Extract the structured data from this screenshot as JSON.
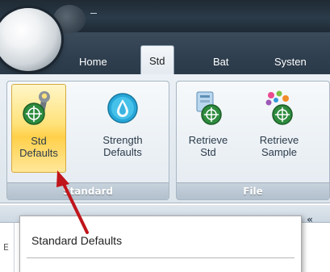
{
  "ribbon": {
    "tabs": [
      {
        "label": "Home"
      },
      {
        "label": "Std"
      },
      {
        "label": "Bat"
      },
      {
        "label": "Systen"
      }
    ],
    "active_tab": "Std",
    "groups": [
      {
        "label": "Standard",
        "buttons": [
          {
            "line1": "Std",
            "line2": "Defaults",
            "icon": "wrench-target-icon",
            "selected": true
          },
          {
            "line1": "Strength",
            "line2": "Defaults",
            "icon": "water-drop-icon",
            "selected": false
          }
        ]
      },
      {
        "label": "File",
        "buttons": [
          {
            "line1": "Retrieve",
            "line2": "Std",
            "icon": "retrieve-std-icon",
            "selected": false
          },
          {
            "line1": "Retrieve",
            "line2": "Sample",
            "icon": "retrieve-sample-icon",
            "selected": false
          }
        ]
      }
    ]
  },
  "panel": {
    "collapse_label": "«",
    "left_strip_char": "E"
  },
  "tooltip": {
    "title": "Standard Defaults"
  },
  "colors": {
    "selected_button": "#ffd04a",
    "arrow": "#c0151b",
    "titlebar": "#2b3b49"
  }
}
